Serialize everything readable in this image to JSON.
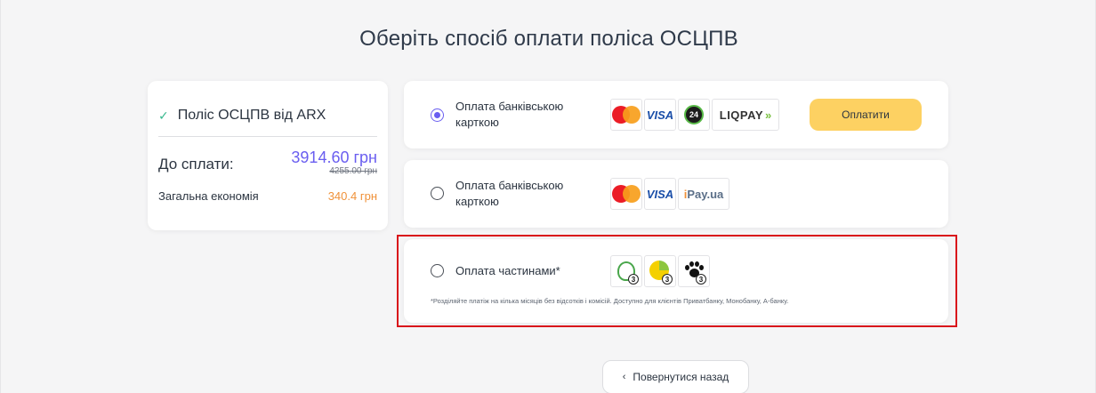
{
  "page": {
    "title": "Оберіть спосіб оплати поліса ОСЦПВ"
  },
  "summary": {
    "policy_name": "Поліс ОСЦПВ від ARX",
    "pay_label": "До сплати:",
    "price": "3914.60 грн",
    "old_price": "4255.00 грн",
    "savings_label": "Загальна економія",
    "savings_value": "340.4 грн"
  },
  "options": [
    {
      "label": "Оплата банківською карткою",
      "selected": true,
      "logos": [
        "mastercard-icon",
        "visa-icon",
        "privat24-icon",
        "liqpay-icon"
      ],
      "liqpay_text": "LIQPAY",
      "visa_text": "VISA",
      "p24_text": "24",
      "button_label": "Оплатити"
    },
    {
      "label": "Оплата банківською карткою",
      "selected": false,
      "logos": [
        "mastercard-icon",
        "visa-icon",
        "ipay-icon"
      ],
      "visa_text": "VISA",
      "ipay_i": "i",
      "ipay_rest": "Pay.ua"
    },
    {
      "label": "Оплата частинами*",
      "selected": false,
      "logos": [
        "privatbank-installments-icon",
        "monobank-installments-icon",
        "abank-installments-icon"
      ],
      "installment_count": "3",
      "footnote": "*Розділяйте платіж на кілька місяців без відсотків і комісій. Доступно для клієнтів Приватбанку, Монобанку, А-банку."
    }
  ],
  "back_button": {
    "label": "Повернутися назад"
  },
  "colors": {
    "accent": "#6a5ef0",
    "savings": "#f0923a",
    "pay_button": "#fdd162",
    "highlight": "#d9141b"
  }
}
